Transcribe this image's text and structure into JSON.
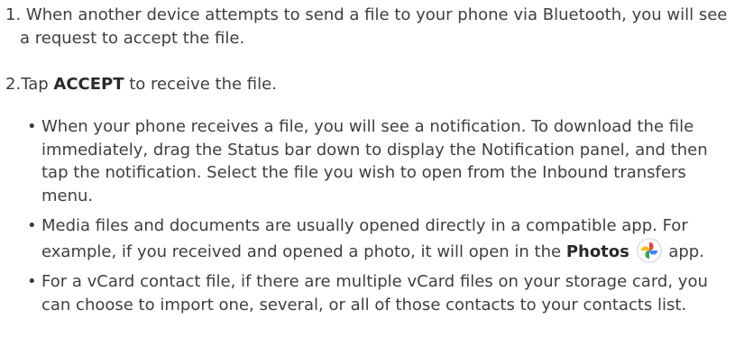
{
  "steps": [
    {
      "number": "1.",
      "text": "When another device attempts to send a file to your phone via Bluetooth, you will see a request to accept the file."
    },
    {
      "number": "2.",
      "pre": "Tap ",
      "bold": "ACCEPT",
      "post": " to receive the file."
    }
  ],
  "bullets": {
    "marker": "•",
    "item1": "When your phone receives a file, you will see a notification. To download the file immediately, drag the Status bar down to display the Notification panel, and then tap the notification. Select the file you wish to open from the Inbound transfers menu.",
    "item2_pre": "Media files and documents are usually opened directly in a compatible app. For example, if you received and opened a photo, it will open in the ",
    "item2_bold": "Photos",
    "item2_post": " app.",
    "item3": "For a vCard contact file, if there are multiple vCard files on your storage card, you can choose to import one, several, or all of those contacts to your contacts list."
  },
  "icons": {
    "photos": "photos-pinwheel-icon"
  },
  "colors": {
    "text": "#3f3f3f",
    "photos_red": "#ea4335",
    "photos_yellow": "#fbbc04",
    "photos_green": "#34a853",
    "photos_blue": "#4285f4"
  }
}
